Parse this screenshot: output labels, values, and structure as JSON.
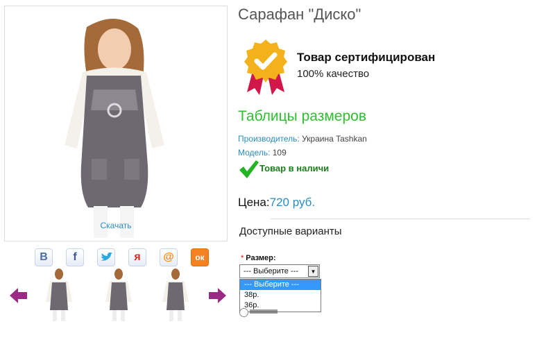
{
  "product": {
    "title": "Сарафан \"Диско\"",
    "download_label": "Скачать"
  },
  "certificate": {
    "title": "Товар сертифицирован",
    "subtitle": "100% качество",
    "icon": "certified-badge-icon",
    "badge_color": "#f3b21c",
    "ribbon_color": "#d2164a"
  },
  "size_tables_link": "Таблицы размеров",
  "meta": {
    "manufacturer_label": "Производитель:",
    "manufacturer_value": " Украина Tashkan",
    "model_label": "Модель:",
    "model_value": " 109"
  },
  "stock": {
    "label": "Товар в наличи",
    "icon": "green-check-icon"
  },
  "price": {
    "label": "Цена:",
    "value": "720 руб."
  },
  "variants_heading": "Доступные варианты",
  "size_option": {
    "required_mark": "*",
    "label": "Размер:",
    "selected": "--- Выберите ---",
    "options": [
      "--- Выберите ---",
      "38р.",
      "36р."
    ]
  },
  "social": [
    {
      "name": "vk",
      "glyph": "В",
      "color": "#4a6f9e"
    },
    {
      "name": "facebook",
      "glyph": "f",
      "color": "#3b5998"
    },
    {
      "name": "twitter",
      "glyph": "🐦",
      "color": "#2aa9e0"
    },
    {
      "name": "moikrug",
      "glyph": "я",
      "color": "#d52b1e"
    },
    {
      "name": "mailru",
      "glyph": "@",
      "color": "#ff8a00"
    },
    {
      "name": "odnoklassniki",
      "glyph": "ок",
      "color": "#f58220"
    }
  ],
  "colors": {
    "accent_blue": "#2a8dc5",
    "accent_green": "#2fbf2f",
    "arrow": "#9b2a84"
  }
}
